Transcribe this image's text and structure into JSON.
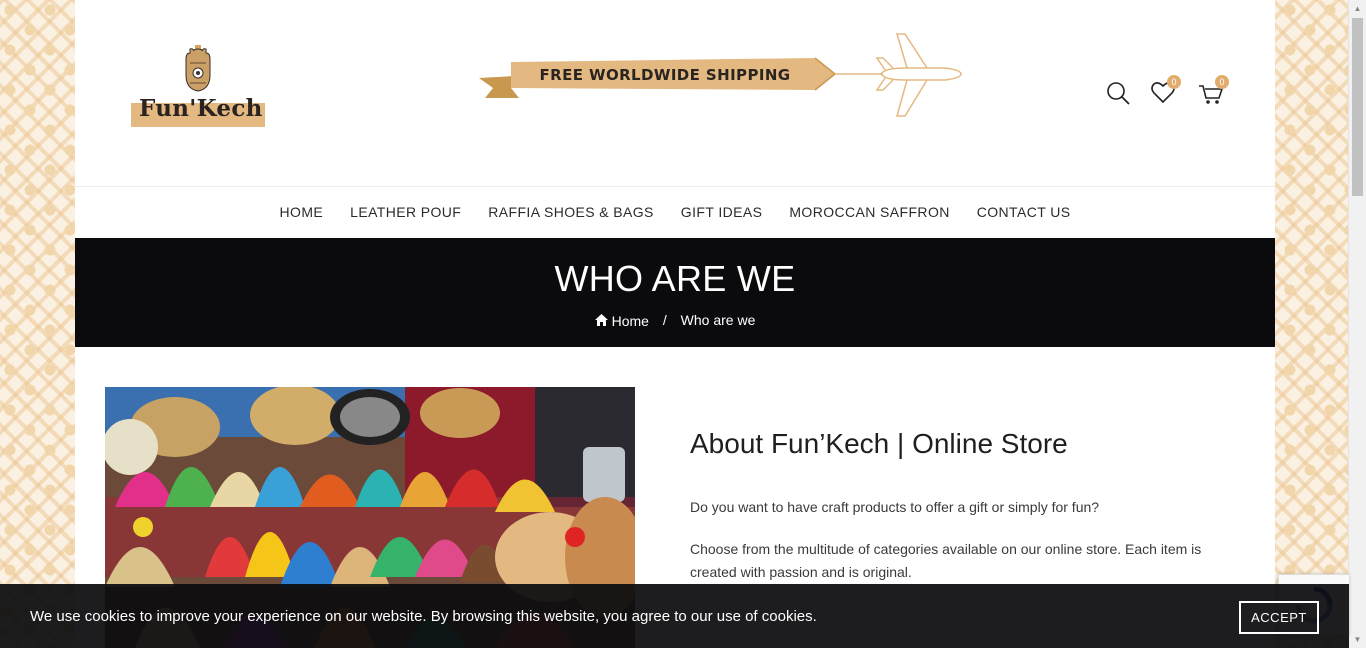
{
  "header": {
    "logo_text": "Fun'Kech",
    "promo_text": "FREE WORLDWIDE SHIPPING",
    "icons": {
      "search": "search-icon",
      "wishlist": "heart-icon",
      "cart": "cart-icon"
    },
    "wishlist_count": "0",
    "cart_count": "0"
  },
  "nav": {
    "items": [
      {
        "label": "HOME"
      },
      {
        "label": "LEATHER POUF"
      },
      {
        "label": "RAFFIA SHOES & BAGS"
      },
      {
        "label": "GIFT IDEAS"
      },
      {
        "label": "MOROCCAN SAFFRON"
      },
      {
        "label": "CONTACT US"
      }
    ]
  },
  "hero": {
    "title": "WHO ARE WE",
    "breadcrumb_home": "Home",
    "breadcrumb_separator": "/",
    "breadcrumb_current": "Who are we"
  },
  "about": {
    "heading": "About Fun’Kech | Online Store",
    "p1": "Do you want to have craft products to offer a gift or simply for fun?",
    "p2": "Choose from the multitude of categories available on our online store. Each item is created with passion and is original."
  },
  "cookie": {
    "message": "We use cookies to improve your experience on our website. By browsing this website, you agree to our use of cookies.",
    "accept_label": "ACCEPT"
  },
  "colors": {
    "accent": "#e2ad6c",
    "hero_bg": "#0b0b0d",
    "pattern": "#f1d6ab"
  }
}
